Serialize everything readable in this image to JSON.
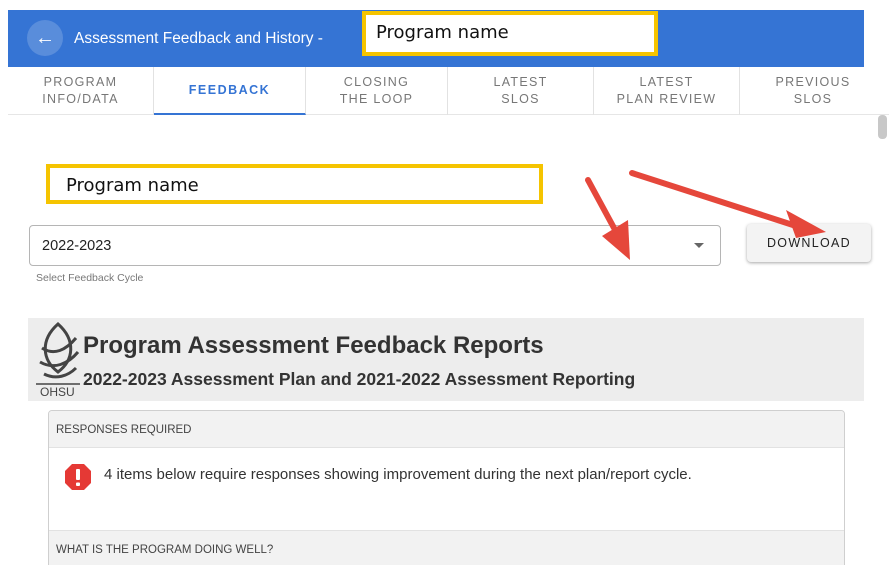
{
  "header": {
    "title": "Assessment Feedback and History -",
    "program_highlight": "Program name"
  },
  "tabs": [
    {
      "label": "PROGRAM INFO/DATA",
      "line1": "PROGRAM",
      "line2": "INFO/DATA",
      "active": false
    },
    {
      "label": "FEEDBACK",
      "line1": "FEEDBACK",
      "line2": "",
      "active": true
    },
    {
      "label": "CLOSING THE LOOP",
      "line1": "CLOSING",
      "line2": "THE LOOP",
      "active": false
    },
    {
      "label": "LATEST SLOS",
      "line1": "LATEST",
      "line2": "SLOS",
      "active": false
    },
    {
      "label": "LATEST PLAN REVIEW",
      "line1": "LATEST",
      "line2": "PLAN REVIEW",
      "active": false
    },
    {
      "label": "PREVIOUS SLOS",
      "line1": "PREVIOUS",
      "line2": "SLOS",
      "active": false
    }
  ],
  "body": {
    "program_highlight": "Program name"
  },
  "cycle_select": {
    "value": "2022-2023",
    "helper": "Select Feedback Cycle"
  },
  "download_button": "DOWNLOAD",
  "report": {
    "logo_text": "OHSU",
    "title": "Program Assessment Feedback Reports",
    "subtitle": "2022-2023 Assessment Plan and 2021-2022 Assessment Reporting"
  },
  "responses_card": {
    "heading": "RESPONSES REQUIRED",
    "message": "4 items below require responses showing improvement during the next plan/report cycle.",
    "next_heading": "WHAT IS THE PROGRAM DOING WELL?"
  },
  "colors": {
    "appbar": "#3574d4",
    "highlight_border": "#f5c400",
    "annotation_arrow": "#e5473b",
    "alert": "#e53935",
    "active_tab": "#3574d4"
  }
}
